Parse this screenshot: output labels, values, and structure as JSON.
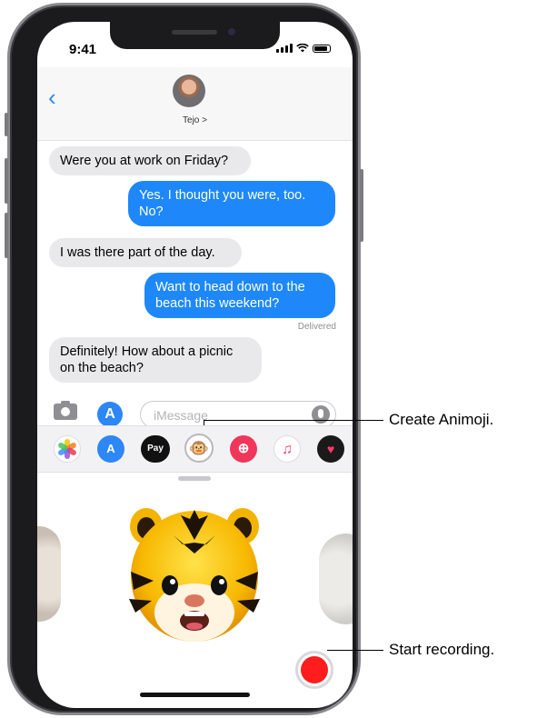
{
  "status_bar": {
    "time": "9:41"
  },
  "header": {
    "back_glyph": "‹",
    "contact_name": "Tejo >"
  },
  "messages": [
    {
      "direction": "incoming",
      "text": "Were you at work on Friday?"
    },
    {
      "direction": "outgoing",
      "text": "Yes. I thought you were, too. No?"
    },
    {
      "direction": "incoming",
      "text": "I was there part of the day."
    },
    {
      "direction": "outgoing",
      "text": "Want to head down to the beach this weekend?"
    },
    {
      "direction": "incoming",
      "text": "Definitely! How about a picnic on the beach?"
    }
  ],
  "delivered_label": "Delivered",
  "input": {
    "placeholder": "iMessage",
    "value": ""
  },
  "app_drawer": {
    "apps": [
      {
        "name": "Photos",
        "icon": "photos-icon",
        "glyph": ""
      },
      {
        "name": "App Store",
        "icon": "app-store-icon",
        "glyph": "A"
      },
      {
        "name": "Apple Pay",
        "icon": "apple-pay-icon",
        "glyph": "Pay"
      },
      {
        "name": "Animoji",
        "icon": "animoji-icon",
        "glyph": "🐵"
      },
      {
        "name": "Images",
        "icon": "image-search-icon",
        "glyph": "⊕"
      },
      {
        "name": "Music",
        "icon": "music-icon",
        "glyph": "♫"
      },
      {
        "name": "Digital Touch",
        "icon": "heart-icon",
        "glyph": "♥"
      }
    ]
  },
  "callouts": {
    "create_animoji": "Create Animoji.",
    "start_recording": "Start recording."
  },
  "colors": {
    "outgoing_bubble": "#1e88fa",
    "incoming_bubble": "#e9e9eb",
    "record": "#ff1d1d",
    "accent": "#2d87f5"
  }
}
